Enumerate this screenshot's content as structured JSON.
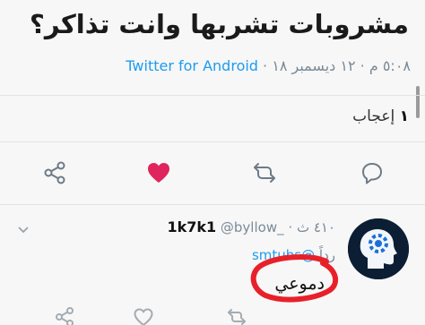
{
  "tweet": {
    "text": "مشروبات تشربها وانت تذاكر؟",
    "time": "٥:٠٨ م",
    "date": "١٢ ديسمبر ١٨",
    "client": "Twitter for Android",
    "separator": "·"
  },
  "engagement": {
    "likes_count": "١",
    "likes_label": "إعجاب"
  },
  "actions": {
    "icons": [
      "reply-icon",
      "retweet-icon",
      "heart-icon",
      "share-icon"
    ],
    "like_color": "#e0245e"
  },
  "reply": {
    "display_name": "1k7k1",
    "handle": "@byllow_",
    "time_ago": "٤١٠ ث",
    "separator": "·",
    "replying_to_prefix": "رداً",
    "replying_to_handle": "@smtubs",
    "text": "دموعي",
    "highlight_color": "#e8202a"
  },
  "colors": {
    "link": "#1d9bf0",
    "muted": "#7b8a97",
    "background": "#f7f7f7"
  }
}
